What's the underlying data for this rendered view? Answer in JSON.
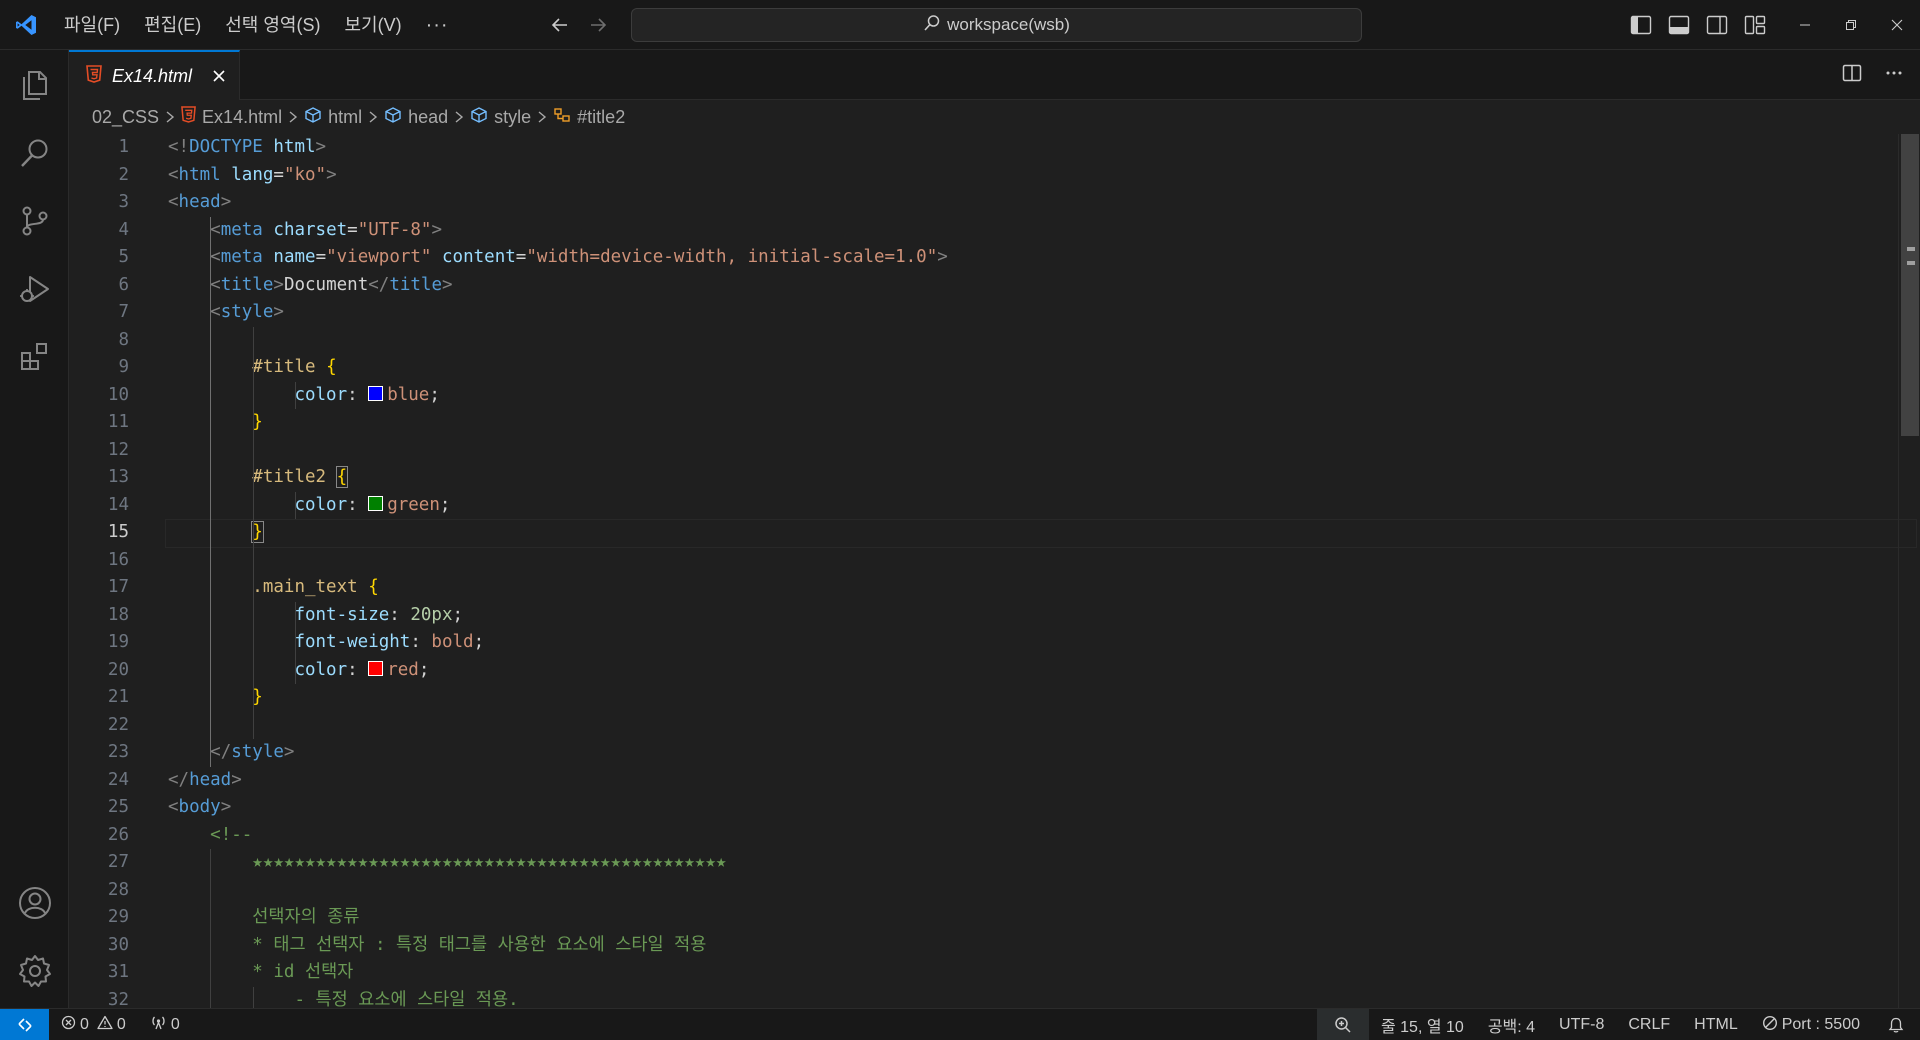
{
  "titlebar": {
    "menu": [
      "파일(F)",
      "편집(E)",
      "선택 영역(S)",
      "보기(V)",
      "···"
    ],
    "search_text": "workspace(wsb)"
  },
  "tab": {
    "label": "Ex14.html",
    "close": "×"
  },
  "breadcrumb": {
    "folder": "02_CSS",
    "file": "Ex14.html",
    "html": "html",
    "head": "head",
    "style": "style",
    "selector": "#title2"
  },
  "editor": {
    "lines": [
      {
        "n": "1",
        "seg": [
          [
            "t-br",
            "<!"
          ],
          [
            "t-tag",
            "DOCTYPE"
          ],
          [
            "t-text",
            " "
          ],
          [
            "t-attr",
            "html"
          ],
          [
            "t-br",
            ">"
          ]
        ]
      },
      {
        "n": "2",
        "seg": [
          [
            "t-br",
            "<"
          ],
          [
            "t-tag",
            "html"
          ],
          [
            "t-text",
            " "
          ],
          [
            "t-attr",
            "lang"
          ],
          [
            "t-punct",
            "="
          ],
          [
            "t-str",
            "\"ko\""
          ],
          [
            "t-br",
            ">"
          ]
        ]
      },
      {
        "n": "3",
        "seg": [
          [
            "t-br",
            "<"
          ],
          [
            "t-tag",
            "head"
          ],
          [
            "t-br",
            ">"
          ]
        ]
      },
      {
        "n": "4",
        "seg": [
          [
            "t-text",
            "    "
          ],
          [
            "t-br",
            "<"
          ],
          [
            "t-tag",
            "meta"
          ],
          [
            "t-text",
            " "
          ],
          [
            "t-attr",
            "charset"
          ],
          [
            "t-punct",
            "="
          ],
          [
            "t-str",
            "\"UTF-8\""
          ],
          [
            "t-br",
            ">"
          ]
        ]
      },
      {
        "n": "5",
        "seg": [
          [
            "t-text",
            "    "
          ],
          [
            "t-br",
            "<"
          ],
          [
            "t-tag",
            "meta"
          ],
          [
            "t-text",
            " "
          ],
          [
            "t-attr",
            "name"
          ],
          [
            "t-punct",
            "="
          ],
          [
            "t-str",
            "\"viewport\""
          ],
          [
            "t-text",
            " "
          ],
          [
            "t-attr",
            "content"
          ],
          [
            "t-punct",
            "="
          ],
          [
            "t-str",
            "\"width=device-width, initial-scale=1.0\""
          ],
          [
            "t-br",
            ">"
          ]
        ]
      },
      {
        "n": "6",
        "seg": [
          [
            "t-text",
            "    "
          ],
          [
            "t-br",
            "<"
          ],
          [
            "t-tag",
            "title"
          ],
          [
            "t-br",
            ">"
          ],
          [
            "t-text",
            "Document"
          ],
          [
            "t-br",
            "</"
          ],
          [
            "t-tag",
            "title"
          ],
          [
            "t-br",
            ">"
          ]
        ]
      },
      {
        "n": "7",
        "seg": [
          [
            "t-text",
            "    "
          ],
          [
            "t-br",
            "<"
          ],
          [
            "t-tag",
            "style"
          ],
          [
            "t-br",
            ">"
          ]
        ]
      },
      {
        "n": "8",
        "seg": []
      },
      {
        "n": "9",
        "seg": [
          [
            "t-text",
            "        "
          ],
          [
            "t-sel",
            "#title"
          ],
          [
            "t-text",
            " "
          ],
          [
            "t-brace",
            "{"
          ]
        ]
      },
      {
        "n": "10",
        "seg": [
          [
            "t-text",
            "            "
          ],
          [
            "t-prop",
            "color"
          ],
          [
            "t-punct",
            ": "
          ],
          [
            "swatch",
            "#0000ff"
          ],
          [
            "t-val",
            "blue"
          ],
          [
            "t-punct",
            ";"
          ]
        ]
      },
      {
        "n": "11",
        "seg": [
          [
            "t-text",
            "        "
          ],
          [
            "t-brace",
            "}"
          ]
        ]
      },
      {
        "n": "12",
        "seg": []
      },
      {
        "n": "13",
        "seg": [
          [
            "t-text",
            "        "
          ],
          [
            "t-sel",
            "#title2"
          ],
          [
            "t-text",
            " "
          ],
          [
            "t-brace-m",
            "{"
          ]
        ]
      },
      {
        "n": "14",
        "seg": [
          [
            "t-text",
            "            "
          ],
          [
            "t-prop",
            "color"
          ],
          [
            "t-punct",
            ": "
          ],
          [
            "swatch",
            "#008000"
          ],
          [
            "t-val",
            "green"
          ],
          [
            "t-punct",
            ";"
          ]
        ]
      },
      {
        "n": "15",
        "seg": [
          [
            "t-text",
            "        "
          ],
          [
            "t-brace-m",
            "}"
          ]
        ],
        "current": true
      },
      {
        "n": "16",
        "seg": []
      },
      {
        "n": "17",
        "seg": [
          [
            "t-text",
            "        "
          ],
          [
            "t-sel",
            ".main_text"
          ],
          [
            "t-text",
            " "
          ],
          [
            "t-brace",
            "{"
          ]
        ]
      },
      {
        "n": "18",
        "seg": [
          [
            "t-text",
            "            "
          ],
          [
            "t-prop",
            "font-size"
          ],
          [
            "t-punct",
            ": "
          ],
          [
            "t-num",
            "20px"
          ],
          [
            "t-punct",
            ";"
          ]
        ]
      },
      {
        "n": "19",
        "seg": [
          [
            "t-text",
            "            "
          ],
          [
            "t-prop",
            "font-weight"
          ],
          [
            "t-punct",
            ": "
          ],
          [
            "t-val",
            "bold"
          ],
          [
            "t-punct",
            ";"
          ]
        ]
      },
      {
        "n": "20",
        "seg": [
          [
            "t-text",
            "            "
          ],
          [
            "t-prop",
            "color"
          ],
          [
            "t-punct",
            ": "
          ],
          [
            "swatch",
            "#ff0000"
          ],
          [
            "t-val",
            "red"
          ],
          [
            "t-punct",
            ";"
          ]
        ]
      },
      {
        "n": "21",
        "seg": [
          [
            "t-text",
            "        "
          ],
          [
            "t-brace",
            "}"
          ]
        ]
      },
      {
        "n": "22",
        "seg": []
      },
      {
        "n": "23",
        "seg": [
          [
            "t-text",
            "    "
          ],
          [
            "t-br",
            "</"
          ],
          [
            "t-tag",
            "style"
          ],
          [
            "t-br",
            ">"
          ]
        ]
      },
      {
        "n": "24",
        "seg": [
          [
            "t-br",
            "</"
          ],
          [
            "t-tag",
            "head"
          ],
          [
            "t-br",
            ">"
          ]
        ]
      },
      {
        "n": "25",
        "seg": [
          [
            "t-br",
            "<"
          ],
          [
            "t-tag",
            "body"
          ],
          [
            "t-br",
            ">"
          ]
        ]
      },
      {
        "n": "26",
        "seg": [
          [
            "t-text",
            "    "
          ],
          [
            "t-cmt",
            "<!--"
          ]
        ]
      },
      {
        "n": "27",
        "seg": [
          [
            "t-text",
            "        "
          ],
          [
            "t-cmt",
            "★★★★★★★★★★★★★★★★★★★★★★★★★★★★★★★★★★★★★★★★★★★★★"
          ]
        ]
      },
      {
        "n": "28",
        "seg": []
      },
      {
        "n": "29",
        "seg": [
          [
            "t-text",
            "        "
          ],
          [
            "t-cmt",
            "선택자의 종류"
          ]
        ]
      },
      {
        "n": "30",
        "seg": [
          [
            "t-text",
            "        "
          ],
          [
            "t-cmt",
            "* 태그 선택자 : 특정 태그를 사용한 요소에 스타일 적용"
          ]
        ]
      },
      {
        "n": "31",
        "seg": [
          [
            "t-text",
            "        "
          ],
          [
            "t-cmt",
            "* id 선택자"
          ]
        ]
      },
      {
        "n": "32",
        "seg": [
          [
            "t-text",
            "            "
          ],
          [
            "t-cmt",
            "- 특정 요소에 스타일 적용."
          ]
        ]
      }
    ]
  },
  "statusbar": {
    "errors": "0",
    "warnings": "0",
    "ports": "0",
    "position": "줄 15, 열 10",
    "spaces": "공백: 4",
    "encoding": "UTF-8",
    "eol": "CRLF",
    "language": "HTML",
    "port": "Port : 5500"
  },
  "icons": [
    "vscode-logo-icon",
    "arrow-left-icon",
    "arrow-right-icon",
    "search-icon",
    "toggle-primary-sidebar-icon",
    "toggle-panel-icon",
    "toggle-secondary-sidebar-icon",
    "customize-layout-icon",
    "minimize-icon",
    "restore-icon",
    "close-icon",
    "explorer-icon",
    "search-icon",
    "source-control-icon",
    "run-debug-icon",
    "extensions-icon",
    "accounts-icon",
    "manage-gear-icon",
    "html5-file-icon",
    "split-editor-icon",
    "more-actions-icon",
    "remote-icon",
    "error-icon",
    "warning-icon",
    "broadcast-icon",
    "zoom-icon",
    "no-port-icon",
    "bell-icon"
  ],
  "colors": {
    "accent": "#0078d4",
    "html_icon": "#e44d26",
    "background": "#1f1f1f"
  }
}
